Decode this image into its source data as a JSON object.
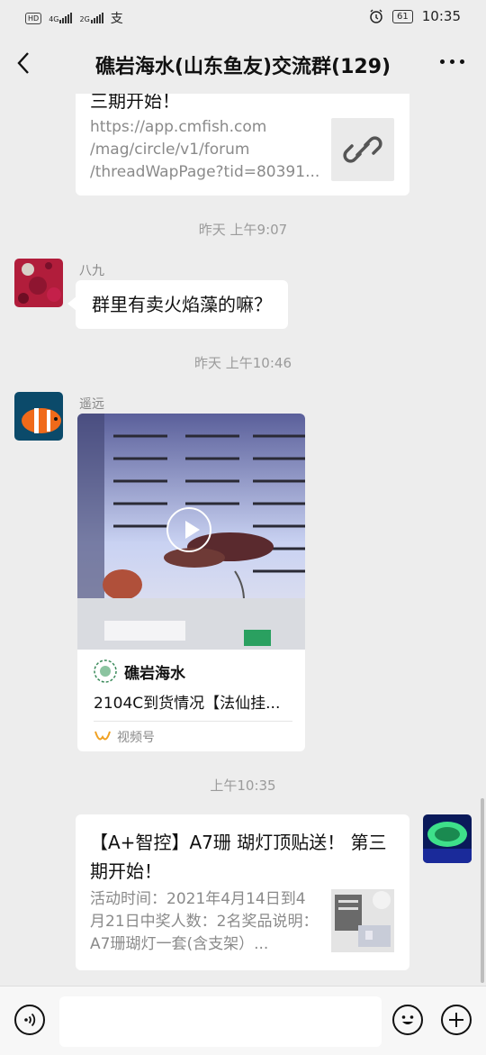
{
  "status_bar": {
    "left_chips": [
      "HD",
      "4G",
      "2G"
    ],
    "left_char": "支",
    "time": "10:35",
    "battery": "61"
  },
  "header": {
    "title": "礁岩海水(山东鱼友)交流群(129)",
    "back_icon": "chevron-left-icon",
    "more_icon": "more-horizontal-icon"
  },
  "messages": {
    "link1": {
      "title_tail": "三期开始！",
      "desc": "https://app.cmfish.com\n/mag/circle/v1/forum\n/threadWapPage?tid=80391...",
      "icon": "link-icon"
    },
    "time1": "昨天 上午9:07",
    "msg1": {
      "sender": "八九",
      "text": "群里有卖火焰藻的嘛？"
    },
    "time2": "昨天 上午10:46",
    "msg2": {
      "sender": "遥远",
      "channel_name": "礁岩海水",
      "video_desc": "2104C到货情况【法仙挂...",
      "source": "视频号"
    },
    "time3": "上午10:35",
    "link2": {
      "title": "【A+智控】A7珊 瑚灯顶贴送！ 第三期开始！",
      "desc": "活动时间：2021年4月14日到4月21日中奖人数：2名奖品说明：A7珊瑚灯一套(含支架）..."
    }
  },
  "input_bar": {
    "voice_icon": "voice-icon",
    "emoji_icon": "emoji-icon",
    "add_icon": "plus-circle-icon",
    "input_value": ""
  },
  "colors": {
    "background": "#ededed",
    "bubble": "#ffffff",
    "time_text": "#9b9b9b",
    "accent_video": "#f0a020"
  }
}
